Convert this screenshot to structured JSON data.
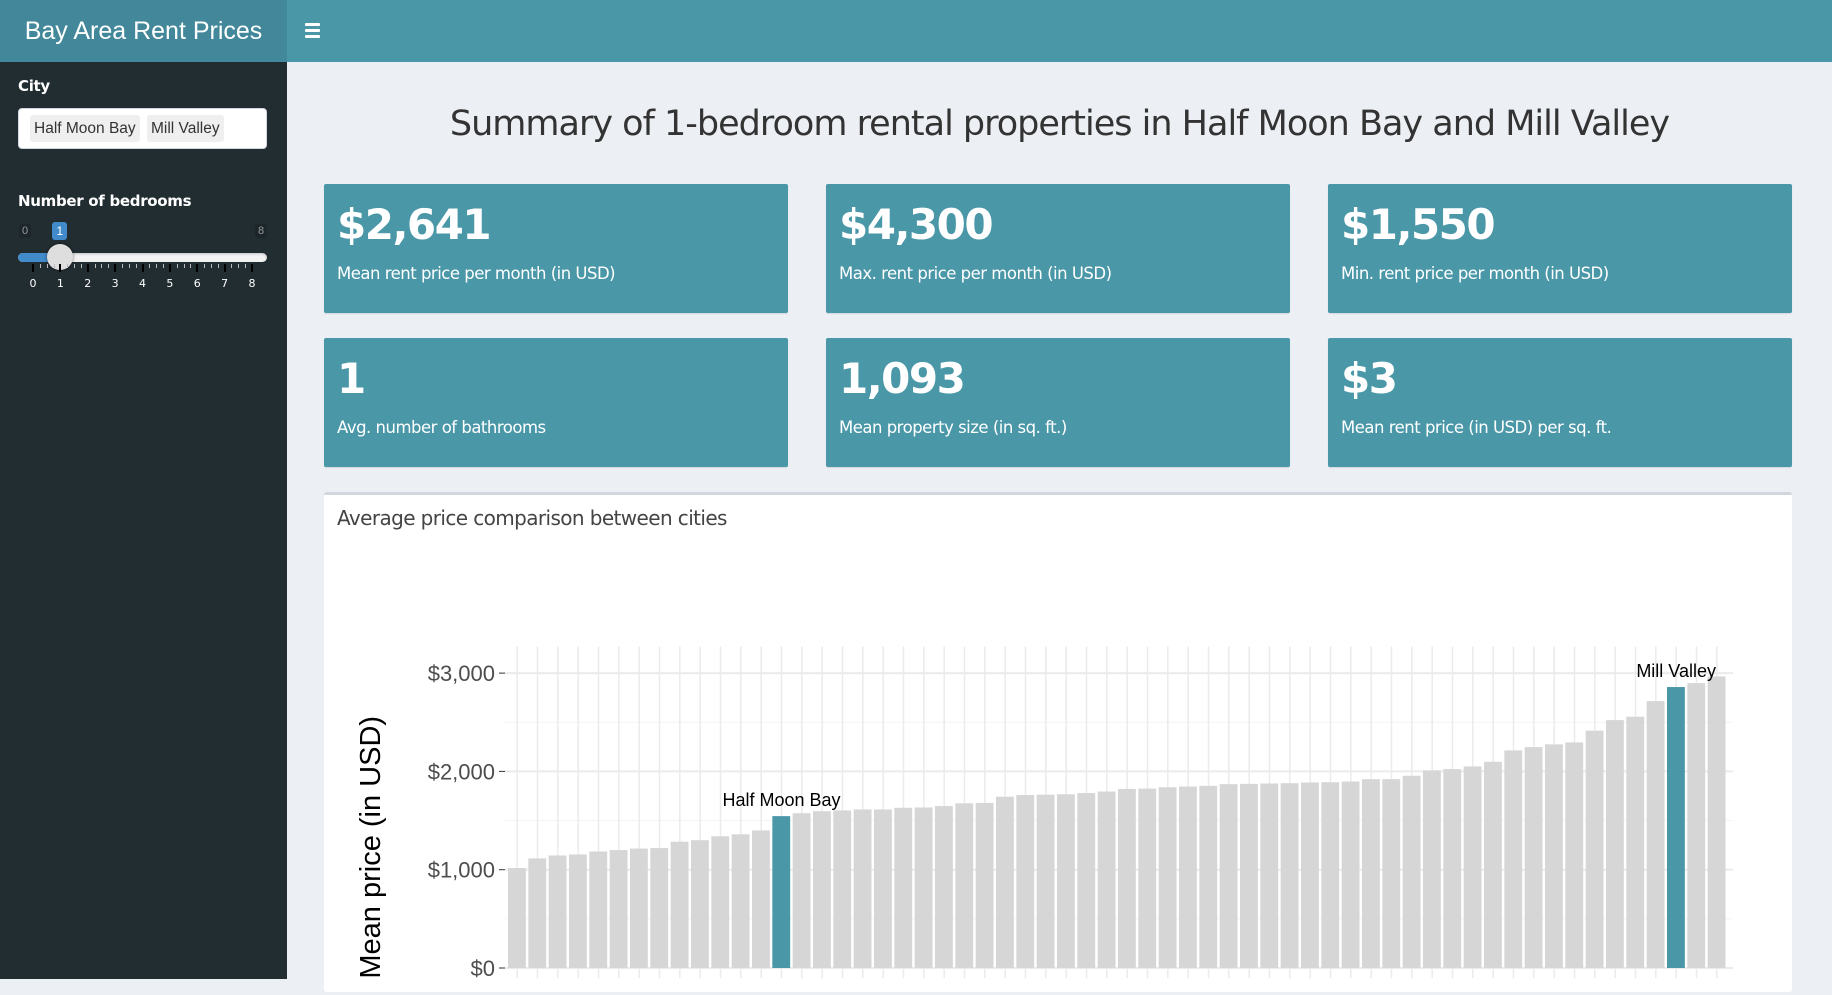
{
  "header": {
    "app_title": "Bay Area Rent Prices",
    "menu_icon": "hamburger-icon"
  },
  "sidebar": {
    "city_label": "City",
    "selected_cities": [
      "Half Moon Bay",
      "Mill Valley"
    ],
    "bedrooms_label": "Number of bedrooms",
    "bedrooms_slider": {
      "min": 0,
      "max": 8,
      "value": 1,
      "min_label": "0",
      "max_label": "8",
      "value_label": "1",
      "tick_labels": [
        "0",
        "1",
        "2",
        "3",
        "4",
        "5",
        "6",
        "7",
        "8"
      ]
    }
  },
  "main": {
    "title": "Summary of 1-bedroom rental properties in Half Moon Bay and Mill Valley",
    "cards": [
      {
        "value": "$2,641",
        "label": "Mean rent price per month (in USD)"
      },
      {
        "value": "$4,300",
        "label": "Max. rent price per month (in USD)"
      },
      {
        "value": "$1,550",
        "label": "Min. rent price per month (in USD)"
      },
      {
        "value": "1",
        "label": "Avg. number of bathrooms"
      },
      {
        "value": "1,093",
        "label": "Mean property size (in sq. ft.)"
      },
      {
        "value": "$3",
        "label": "Mean rent price (in USD) per sq. ft."
      }
    ],
    "chart_box_title": "Average price comparison between cities"
  },
  "colors": {
    "header": "#4a97a8",
    "logo_bg": "#42889a",
    "sidebar": "#222d32",
    "card": "#4a97a8",
    "highlight_bar": "#4a97a8",
    "other_bar": "#d6d6d6",
    "page_bg": "#ecf0f5"
  },
  "chart_data": {
    "type": "bar",
    "title": "Average price comparison between cities",
    "xlabel": "",
    "ylabel": "Mean price (in USD)",
    "ylim": [
      0,
      3270
    ],
    "yticks": [
      0,
      1000,
      2000,
      3000
    ],
    "ytick_labels": [
      "$0",
      "$1,000",
      "$2,000",
      "$3,000"
    ],
    "grid": true,
    "legend": "none",
    "highlighted": [
      {
        "index": 13,
        "label": "Half Moon Bay"
      },
      {
        "index": 57,
        "label": "Mill Valley"
      }
    ],
    "values": [
      1017,
      1115,
      1145,
      1155,
      1185,
      1200,
      1215,
      1220,
      1285,
      1300,
      1340,
      1360,
      1400,
      1545,
      1575,
      1595,
      1603,
      1613,
      1613,
      1630,
      1633,
      1647,
      1675,
      1680,
      1743,
      1760,
      1763,
      1767,
      1780,
      1795,
      1822,
      1825,
      1839,
      1846,
      1853,
      1870,
      1873,
      1877,
      1880,
      1887,
      1890,
      1897,
      1921,
      1921,
      1956,
      2010,
      2024,
      2051,
      2098,
      2214,
      2247,
      2275,
      2295,
      2414,
      2522,
      2556,
      2715,
      2858,
      2898,
      2966
    ]
  }
}
